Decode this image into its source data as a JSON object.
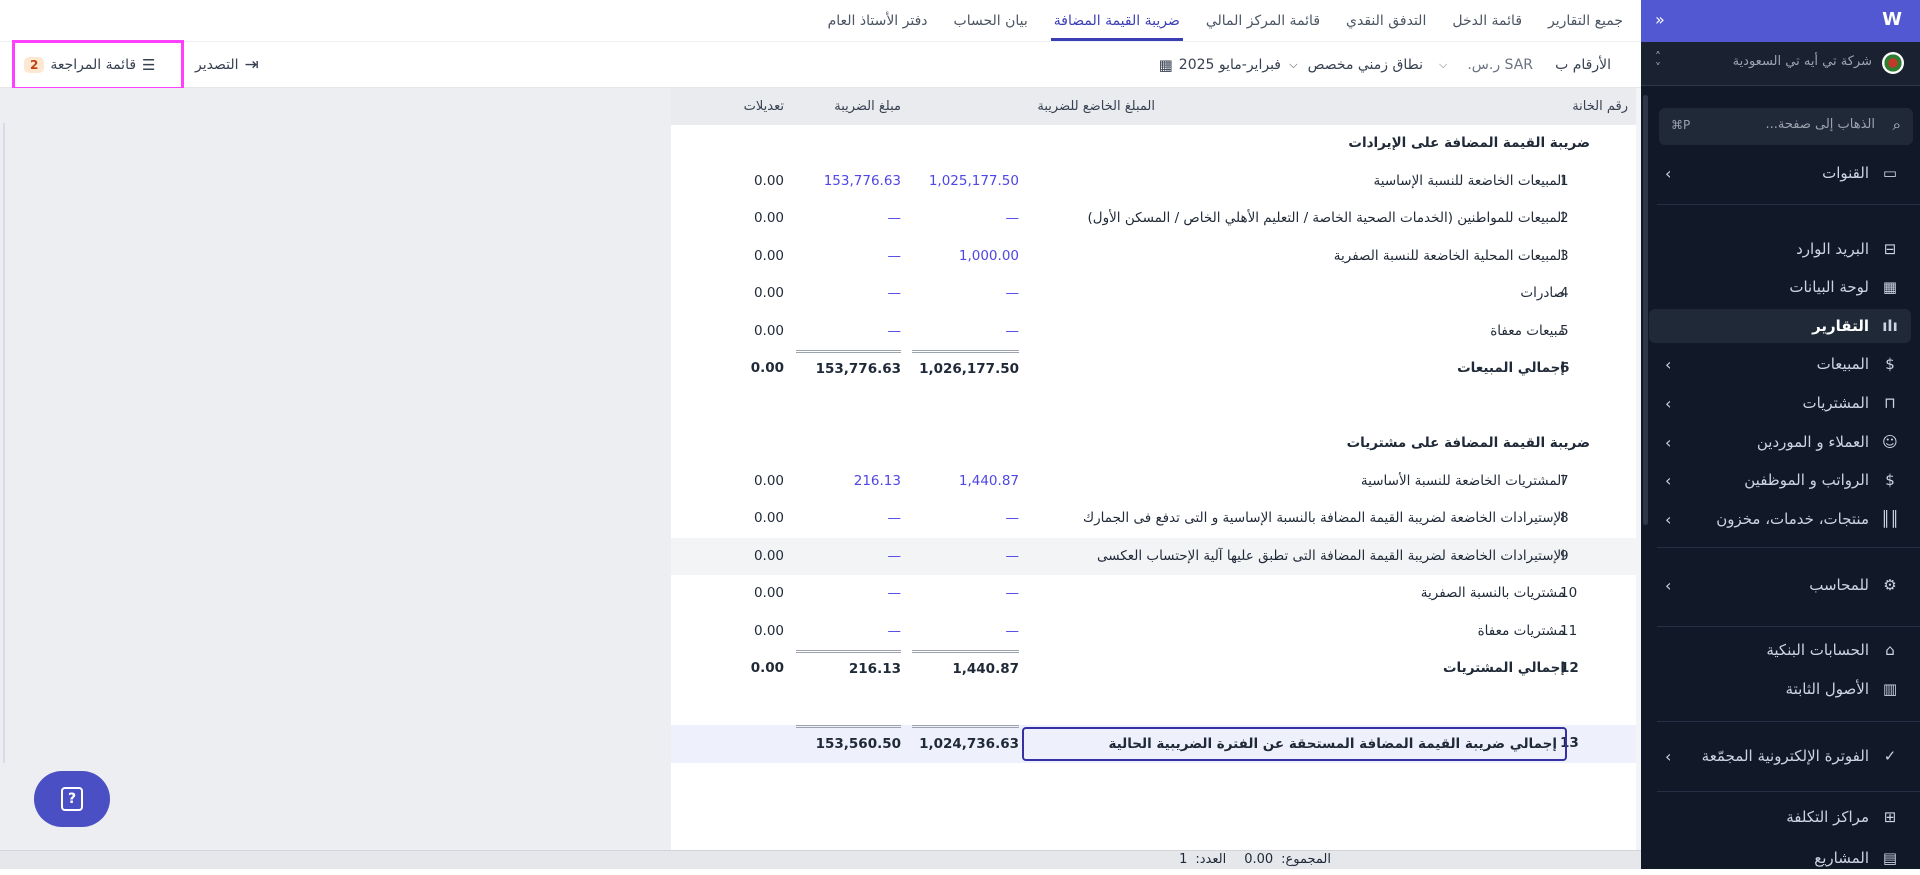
{
  "tabs": [
    {
      "label": "جميع التقارير",
      "active": false
    },
    {
      "label": "قائمة الدخل",
      "active": false
    },
    {
      "label": "التدفق النقدي",
      "active": false
    },
    {
      "label": "قائمة المركز المالي",
      "active": false
    },
    {
      "label": "ضريبة القيمة المضافة",
      "active": true
    },
    {
      "label": "بيان الحساب",
      "active": false
    },
    {
      "label": "دفتر الأستاذ العام",
      "active": false
    }
  ],
  "toolbar": {
    "numbers_in_label": "الأرقام ب",
    "currency": "SAR ر.س.",
    "range_type": "نطاق زمني مخصص",
    "date_range": "فبراير-مايو 2025",
    "export_label": "التصدير",
    "review_list_label": "قائمة المراجعة",
    "review_count": "2"
  },
  "table": {
    "headers": {
      "code": "رقم الخانة",
      "taxable": "المبلغ الخاضع للضريبة",
      "tax": "مبلغ الضريبة",
      "adjustments": "تعديلات"
    },
    "rows": [
      {
        "type": "section",
        "label": "ضريبة القيمة المضافة على الإيرادات"
      },
      {
        "type": "item",
        "code": "1",
        "label": "المبيعات الخاضعة للنسبة الإساسية",
        "taxable": "1,025,177.50",
        "tax": "153,776.63",
        "adj": "0.00"
      },
      {
        "type": "item",
        "code": "2",
        "label": "المبيعات للمواطنين (الخدمات الصحية الخاصة / التعليم الأهلي الخاص / المسكن الأول)",
        "taxable": "—",
        "tax": "—",
        "adj": "0.00"
      },
      {
        "type": "item",
        "code": "3",
        "label": "المبيعات المحلية الخاضعة للنسبة الصفرية",
        "taxable": "1,000.00",
        "tax": "—",
        "adj": "0.00"
      },
      {
        "type": "item",
        "code": "4",
        "label": "صادرات",
        "taxable": "—",
        "tax": "—",
        "adj": "0.00"
      },
      {
        "type": "item",
        "code": "5",
        "label": "مبيعات معفاة",
        "taxable": "—",
        "tax": "—",
        "adj": "0.00"
      },
      {
        "type": "total",
        "code": "6",
        "label": "إجمالي المبيعات",
        "taxable": "1,026,177.50",
        "tax": "153,776.63",
        "adj": "0.00"
      },
      {
        "type": "blank"
      },
      {
        "type": "section",
        "label": "ضريبة القيمة المضافة على مشتريات"
      },
      {
        "type": "item",
        "code": "7",
        "label": "المشتريات الخاضعة للنسبة الأساسية",
        "taxable": "1,440.87",
        "tax": "216.13",
        "adj": "0.00"
      },
      {
        "type": "item",
        "code": "8",
        "label": "الإستيرادات الخاضعة لضريبة القيمة المضافة بالنسبة الإساسية و التى تدفع فى الجمارك",
        "taxable": "—",
        "tax": "—",
        "adj": "0.00"
      },
      {
        "type": "item",
        "code": "9",
        "label": "الإستيرادات الخاضعة لضريبة القيمة المضافة التى تطبق عليها آلية الإحتساب العكسى",
        "taxable": "—",
        "tax": "—",
        "adj": "0.00",
        "highlight": true
      },
      {
        "type": "item",
        "code": "10",
        "label": "مشتريات بالنسبة الصفرية",
        "taxable": "—",
        "tax": "—",
        "adj": "0.00"
      },
      {
        "type": "item",
        "code": "11",
        "label": "مشتريات معفاة",
        "taxable": "—",
        "tax": "—",
        "adj": "0.00"
      },
      {
        "type": "total",
        "code": "12",
        "label": "إجمالي المشتريات",
        "taxable": "1,440.87",
        "tax": "216.13",
        "adj": "0.00"
      },
      {
        "type": "blank"
      },
      {
        "type": "grand",
        "code": "13",
        "label": "إجمالي ضريبة القيمة المضافة المستحقة عن الفترة الضريبية الحالية",
        "taxable": "1,024,736.63",
        "tax": "153,560.50"
      }
    ]
  },
  "status": {
    "sum_label": "المجموع:",
    "sum_value": "0.00",
    "count_label": "العدد:",
    "count_value": "1"
  },
  "sidebar": {
    "company": "شركة تي أيه تي السعودية",
    "search_placeholder": "الذهاب إلى صفحة...",
    "search_shortcut": "⌘P",
    "items": [
      {
        "label": "القنوات",
        "icon": "chat-icon",
        "glyph": "▭",
        "chevron": true
      },
      {
        "label": "البريد الوارد",
        "icon": "inbox-icon",
        "glyph": "⊟",
        "chevron": false
      },
      {
        "label": "لوحة البيانات",
        "icon": "dashboard-icon",
        "glyph": "▦",
        "chevron": false
      },
      {
        "label": "التقارير",
        "icon": "bar-chart-icon",
        "glyph": "ılı",
        "chevron": false,
        "active": true
      },
      {
        "label": "المبيعات",
        "icon": "dollar-icon",
        "glyph": "$",
        "chevron": true
      },
      {
        "label": "المشتريات",
        "icon": "shopping-bag-icon",
        "glyph": "⊓",
        "chevron": true
      },
      {
        "label": "العملاء و الموردين",
        "icon": "users-icon",
        "glyph": "☺",
        "chevron": true
      },
      {
        "label": "الرواتب و الموظفين",
        "icon": "payroll-icon",
        "glyph": "$",
        "chevron": true
      },
      {
        "label": "منتجات، خدمات، مخزون",
        "icon": "barcode-icon",
        "glyph": "║║",
        "chevron": true
      },
      {
        "label": "للمحاسب",
        "icon": "accountant-icon",
        "glyph": "⚙",
        "chevron": true
      },
      {
        "label": "الحسابات البنكية",
        "icon": "bank-icon",
        "glyph": "⌂",
        "chevron": false
      },
      {
        "label": "الأصول الثابتة",
        "icon": "building-icon",
        "glyph": "▥",
        "chevron": false
      },
      {
        "label": "الفوترة الإلكترونية المجمّعة",
        "icon": "checklist-icon",
        "glyph": "✓",
        "chevron": true
      },
      {
        "label": "مراكز التكلفة",
        "icon": "grid-plus-icon",
        "glyph": "⊞",
        "chevron": false
      },
      {
        "label": "المشاريع",
        "icon": "folder-icon",
        "glyph": "▤",
        "chevron": false
      }
    ]
  },
  "colors": {
    "accent": "#5158d1",
    "link": "#4f46e5",
    "sidebar_bg": "#111827",
    "highlight_box": "#ff40ff"
  }
}
